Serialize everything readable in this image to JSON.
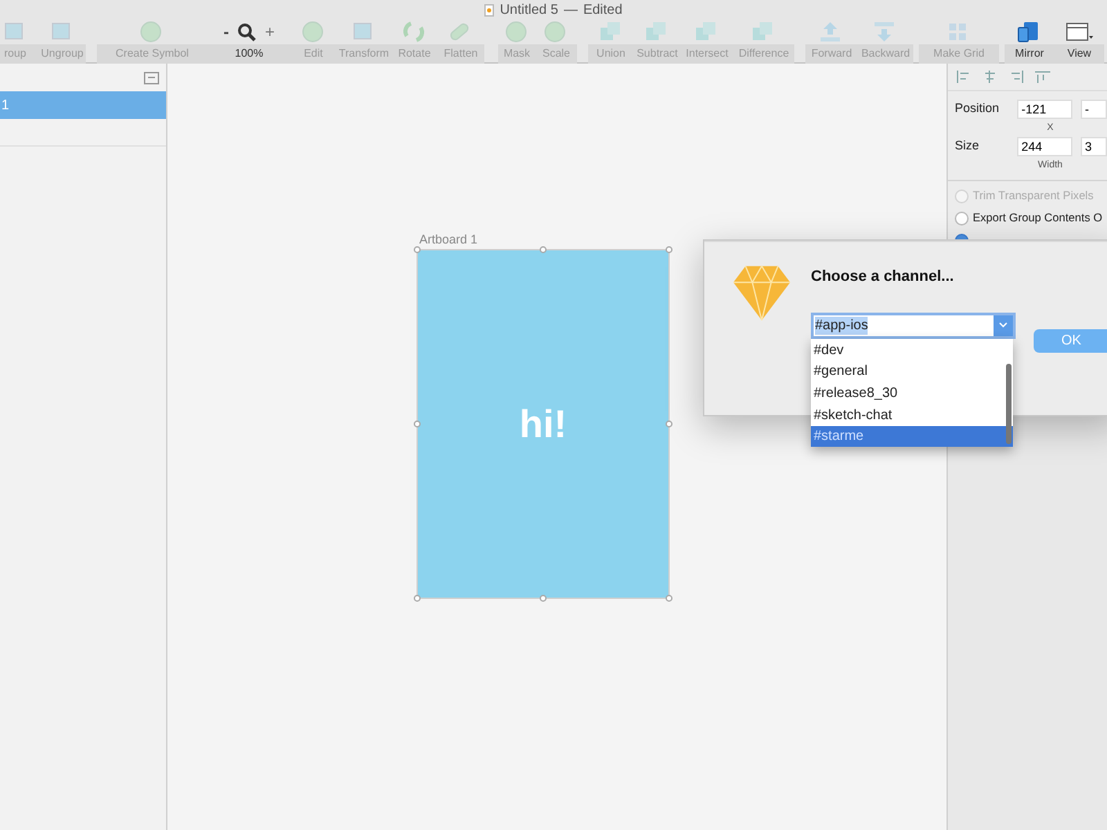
{
  "window": {
    "title": "Untitled 5",
    "separator": "—",
    "status": "Edited"
  },
  "toolbar": [
    {
      "kind": "tool",
      "label": "roup",
      "disabled": true
    },
    {
      "kind": "tool",
      "label": "Ungroup",
      "disabled": true
    },
    {
      "kind": "tool",
      "label": "Create Symbol",
      "disabled": true
    },
    {
      "kind": "zoom",
      "minus": "-",
      "plus": "+",
      "label": "100%",
      "disabled": false
    },
    {
      "kind": "tool",
      "label": "Edit",
      "disabled": true
    },
    {
      "kind": "tool",
      "label": "Transform",
      "disabled": true
    },
    {
      "kind": "tool",
      "label": "Rotate",
      "disabled": true
    },
    {
      "kind": "tool",
      "label": "Flatten",
      "disabled": true
    },
    {
      "kind": "tool",
      "label": "Mask",
      "disabled": true
    },
    {
      "kind": "tool",
      "label": "Scale",
      "disabled": true
    },
    {
      "kind": "tool",
      "label": "Union",
      "disabled": true
    },
    {
      "kind": "tool",
      "label": "Subtract",
      "disabled": true
    },
    {
      "kind": "tool",
      "label": "Intersect",
      "disabled": true
    },
    {
      "kind": "tool",
      "label": "Difference",
      "disabled": true
    },
    {
      "kind": "tool",
      "label": "Forward",
      "disabled": true
    },
    {
      "kind": "tool",
      "label": "Backward",
      "disabled": true
    },
    {
      "kind": "tool",
      "label": "Make Grid",
      "disabled": true
    },
    {
      "kind": "tool",
      "label": "Mirror",
      "disabled": false
    },
    {
      "kind": "tool",
      "label": "View",
      "disabled": false
    }
  ],
  "layers": [
    {
      "label": "1",
      "selected": true
    }
  ],
  "artboard": {
    "name": "Artboard 1",
    "text": "hi!"
  },
  "inspector": {
    "rows": [
      {
        "label": "Position",
        "value_1": "-121",
        "value_2": "-",
        "caption": "X"
      },
      {
        "label": "Size",
        "value_1": "244",
        "value_2": "3",
        "caption": "Width"
      }
    ],
    "checkboxes": [
      {
        "label": "Trim Transparent Pixels",
        "checked": false,
        "disabled": true
      },
      {
        "label": "Export Group Contents O",
        "checked": false,
        "disabled": false
      },
      {
        "checked": true,
        "disabled": false
      }
    ]
  },
  "dialog": {
    "title": "Choose a channel...",
    "value": "#app-ios",
    "options": [
      {
        "label": "#dev",
        "selected": false
      },
      {
        "label": "#general",
        "selected": false
      },
      {
        "label": "#release8_30",
        "selected": false
      },
      {
        "label": "#sketch-chat",
        "selected": false
      },
      {
        "label": "#starme",
        "selected": true
      }
    ],
    "ok": "OK"
  }
}
